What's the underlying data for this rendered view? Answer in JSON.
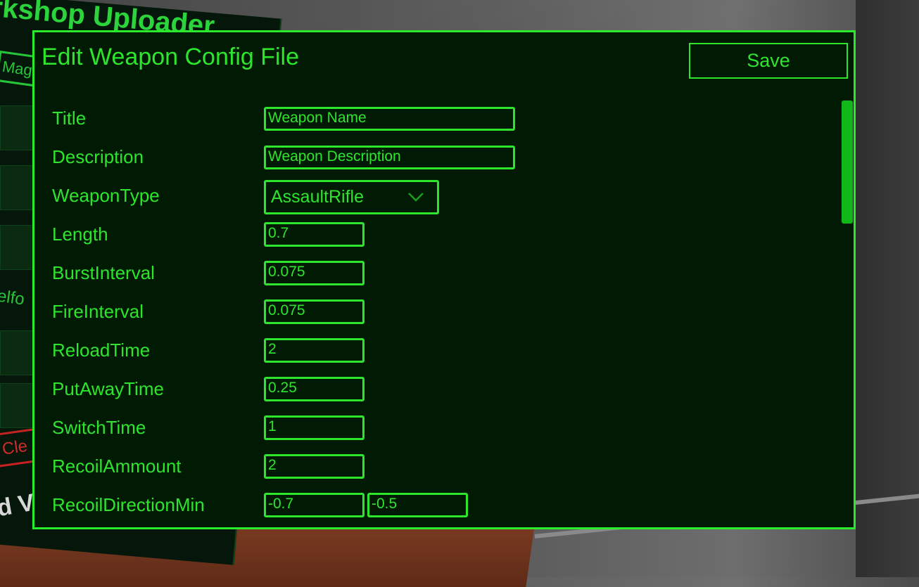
{
  "background": {
    "title": "rkshop Uploader",
    "manage": "Mag",
    "elfo": "elfo",
    "clear": "Cle",
    "bottom_text": "d V"
  },
  "dialog": {
    "title": "Edit Weapon Config File",
    "save_label": "Save"
  },
  "fields": {
    "title": {
      "label": "Title",
      "value": "Weapon Name"
    },
    "description": {
      "label": "Description",
      "value": "Weapon Description"
    },
    "weapon_type": {
      "label": "WeaponType",
      "value": "AssaultRifle"
    },
    "length": {
      "label": "Length",
      "value": "0.7"
    },
    "burst_interval": {
      "label": "BurstInterval",
      "value": "0.075"
    },
    "fire_interval": {
      "label": "FireInterval",
      "value": "0.075"
    },
    "reload_time": {
      "label": "ReloadTime",
      "value": "2"
    },
    "put_away_time": {
      "label": "PutAwayTime",
      "value": "0.25"
    },
    "switch_time": {
      "label": "SwitchTime",
      "value": "1"
    },
    "recoil_ammount": {
      "label": "RecoilAmmount",
      "value": "2"
    },
    "recoil_direction_min": {
      "label": "RecoilDirectionMin",
      "value_x": "-0.7",
      "value_y": "-0.5"
    }
  },
  "colors": {
    "accent": "#2ee52e",
    "panel_bg": "#011a03",
    "scrollbar": "#11b81a"
  }
}
